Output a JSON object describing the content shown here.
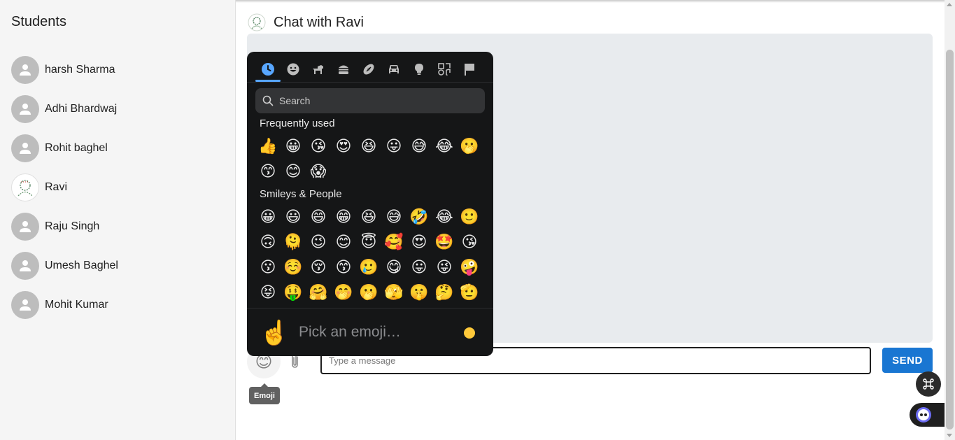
{
  "sidebar": {
    "title": "Students",
    "students": [
      {
        "name": "harsh Sharma",
        "avatar": "person-icon"
      },
      {
        "name": "Adhi Bhardwaj",
        "avatar": "person-icon"
      },
      {
        "name": "Rohit baghel",
        "avatar": "person-icon"
      },
      {
        "name": "Ravi",
        "avatar": "photo"
      },
      {
        "name": "Raju Singh",
        "avatar": "person-icon"
      },
      {
        "name": "Umesh Baghel",
        "avatar": "person-icon"
      },
      {
        "name": "Mohit Kumar",
        "avatar": "person-icon"
      }
    ]
  },
  "chat": {
    "title": "Chat with Ravi",
    "input_placeholder": "Type a message",
    "input_value": "",
    "send_label": "SEND",
    "emoji_tooltip": "Emoji"
  },
  "emoji_picker": {
    "categories": [
      "frequent-clock-icon",
      "smileys-icon",
      "animals-icon",
      "food-icon",
      "activities-icon",
      "travel-icon",
      "objects-icon",
      "symbols-icon",
      "flags-icon"
    ],
    "active_category": "frequent-clock-icon",
    "search_placeholder": "Search",
    "sections": [
      {
        "title": "Frequently used",
        "emojis": [
          "👍",
          "😀",
          "😘",
          "😍",
          "😆",
          "😛",
          "😅",
          "😂",
          "🫢",
          "😙",
          "😊",
          "😱"
        ]
      },
      {
        "title": "Smileys & People",
        "emojis": [
          "😀",
          "😃",
          "😄",
          "😁",
          "😆",
          "😅",
          "🤣",
          "😂",
          "🙂",
          "🙃",
          "🫠",
          "😉",
          "😊",
          "😇",
          "🥰",
          "😍",
          "🤩",
          "😘",
          "😗",
          "☺️",
          "😚",
          "😙",
          "🥲",
          "😋",
          "😛",
          "😜",
          "🤪",
          "😝",
          "🤑",
          "🤗",
          "🤭",
          "🫢",
          "🫣",
          "🤫",
          "🤔",
          "🫡"
        ]
      }
    ],
    "preview_emoji": "☝️",
    "preview_text": "Pick an emoji…",
    "skin_tone_color": "#ffc93a"
  },
  "colors": {
    "send_button": "#1976d2",
    "picker_background": "#151617",
    "active_tab_underline": "#58a6ff",
    "messages_background": "#e8ebee"
  }
}
